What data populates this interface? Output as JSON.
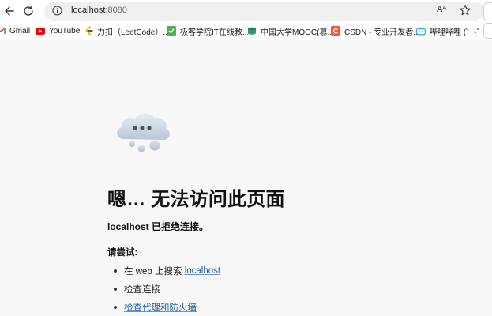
{
  "browser": {
    "url_host": "localhost",
    "url_port": ":8080",
    "read_aloud_label": "Aᴬ",
    "icons": [
      "back-icon",
      "refresh-icon",
      "info-icon",
      "read-aloud-icon",
      "favorite-star-icon"
    ]
  },
  "bookmarks": [
    {
      "label": "Gmail",
      "icon": "gmail-icon"
    },
    {
      "label": "YouTube",
      "icon": "youtube-icon"
    },
    {
      "label": "力扣（LeetCode）...",
      "icon": "leetcode-icon"
    },
    {
      "label": "极客学院IT在线教...",
      "icon": "jikexueyuan-icon"
    },
    {
      "label": "中国大学MOOC(慕...",
      "icon": "mooc-icon"
    },
    {
      "label": "CSDN - 专业开发者...",
      "icon": "csdn-icon"
    },
    {
      "label": "哔哩哔哩 (゜-゜)つ...",
      "icon": "bilibili-icon"
    }
  ],
  "error": {
    "title": "嗯… 无法访问此页面",
    "subtitle": "localhost 已拒绝连接。",
    "try_label": "请尝试:",
    "suggestions": [
      {
        "prefix": "在 web 上搜索 ",
        "link": "localhost"
      },
      {
        "text": "检查连接"
      },
      {
        "link": "检查代理和防火墙"
      }
    ]
  },
  "colors": {
    "page_bg": "#f7f7f7",
    "link": "#1a5fb4",
    "youtube_red": "#ff0000",
    "csdn_orange": "#fc5531",
    "bilibili_blue": "#23ade5",
    "jike_green": "#4caf50"
  }
}
